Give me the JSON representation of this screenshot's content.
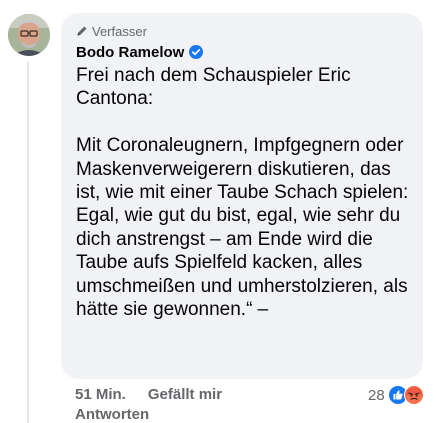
{
  "comment": {
    "role_label": "Verfasser",
    "role_icon": "pencil-icon",
    "author": "Bodo Ramelow",
    "verified_icon": "verified-badge-icon",
    "text": "Frei nach dem Schauspieler Eric Cantona:\n\nMit Coronaleugnern, Impfgegnern oder Maskenverweigerern diskutieren, das ist, wie mit einer Taube Schach spielen: Egal, wie gut du bist, egal, wie sehr du dich anstrengst – am Ende wird die Taube aufs Spielfeld kacken, alles umschmeißen und umherstolzieren, als hätte sie gewonnen.“ –",
    "timestamp": "51 Min.",
    "like_label": "Gefällt mir",
    "reply_label": "Antworten",
    "reaction_count": "28",
    "reactions": [
      "like-icon",
      "angry-icon"
    ]
  },
  "colors": {
    "bubble": "#f0f2f5",
    "verified": "#1877f2",
    "secondary_text": "#65676b",
    "like": "#1877f2",
    "angry": "#f7714c"
  }
}
